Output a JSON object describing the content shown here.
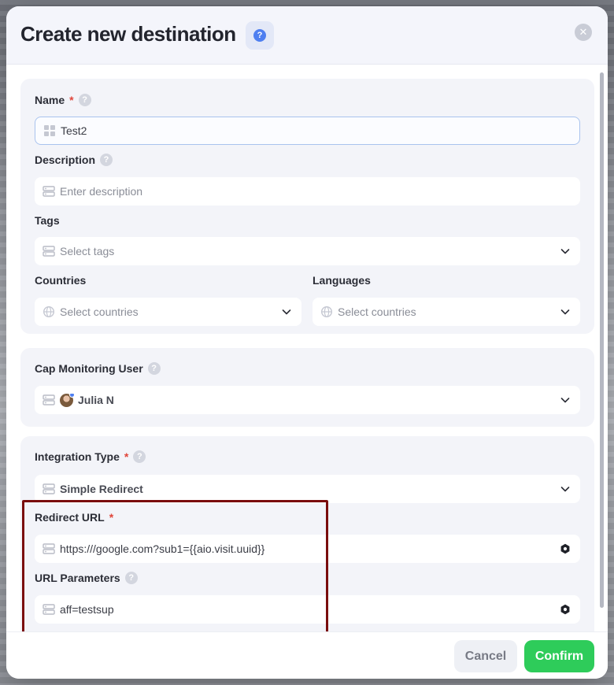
{
  "modal": {
    "title": "Create new destination",
    "help_icon": "question-icon",
    "close_icon": "close-icon"
  },
  "fields": {
    "name": {
      "label": "Name",
      "required_mark": "*",
      "value": "Test2"
    },
    "description": {
      "label": "Description",
      "placeholder": "Enter description"
    },
    "tags": {
      "label": "Tags",
      "placeholder": "Select tags"
    },
    "countries": {
      "label": "Countries",
      "placeholder": "Select countries"
    },
    "languages": {
      "label": "Languages",
      "placeholder": "Select countries"
    },
    "cap_monitoring_user": {
      "label": "Cap Monitoring User",
      "value": "Julia N"
    },
    "integration_type": {
      "label": "Integration Type",
      "required_mark": "*",
      "value": "Simple Redirect"
    },
    "redirect_url": {
      "label": "Redirect URL",
      "required_mark": "*",
      "value": "https:///google.com?sub1={{aio.visit.uuid}}"
    },
    "url_parameters": {
      "label": "URL Parameters",
      "value": "aff=testsup"
    }
  },
  "help_glyph": "?",
  "footer": {
    "cancel_label": "Cancel",
    "confirm_label": "Confirm"
  },
  "colors": {
    "accent_blue": "#4f7ff0",
    "confirm_green": "#2ecc5a",
    "required_red": "#e0453a",
    "highlight_border": "#7a0d0d"
  }
}
